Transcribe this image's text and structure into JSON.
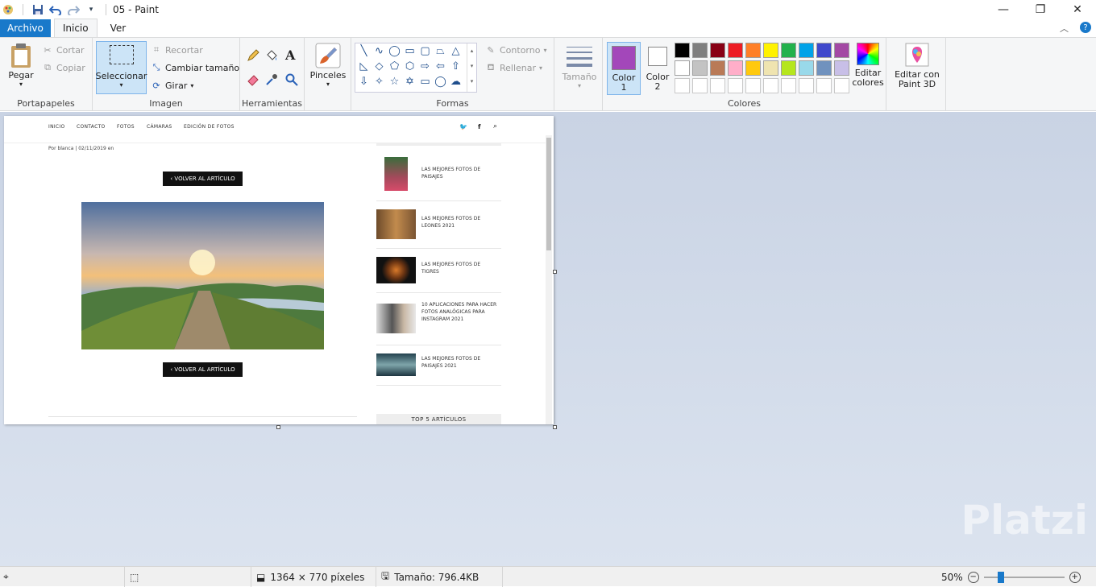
{
  "window": {
    "title": "05 - Paint",
    "minimize": "—",
    "maximize": "❐",
    "close": "✕"
  },
  "tabs": {
    "file": "Archivo",
    "home": "Inicio",
    "view": "Ver"
  },
  "ribbon": {
    "clipboard": {
      "label": "Portapapeles",
      "paste": "Pegar",
      "cut": "Cortar",
      "copy": "Copiar"
    },
    "image": {
      "label": "Imagen",
      "select": "Seleccionar",
      "crop": "Recortar",
      "resize": "Cambiar tamaño",
      "rotate": "Girar"
    },
    "tools": {
      "label": "Herramientas"
    },
    "brushes": {
      "label": "Pinceles"
    },
    "shapes": {
      "label": "Formas",
      "outline": "Contorno",
      "fill": "Rellenar"
    },
    "size": {
      "label": "Tamaño"
    },
    "colors": {
      "label": "Colores",
      "color1": "Color 1",
      "color2": "Color 2",
      "edit": "Editar colores",
      "color1_value": "#a347ba",
      "color2_value": "#ffffff",
      "palette_row1": [
        "#000000",
        "#7f7f7f",
        "#880015",
        "#ed1c24",
        "#ff7f27",
        "#fff200",
        "#22b14c",
        "#00a2e8",
        "#3f48cc",
        "#a349a4"
      ],
      "palette_row2": [
        "#ffffff",
        "#c3c3c3",
        "#b97a57",
        "#ffaec9",
        "#ffc90e",
        "#efe4b0",
        "#b5e61d",
        "#99d9ea",
        "#7092be",
        "#c8bfe7"
      ],
      "palette_row3": [
        "#ffffff",
        "#ffffff",
        "#ffffff",
        "#ffffff",
        "#ffffff",
        "#ffffff",
        "#ffffff",
        "#ffffff",
        "#ffffff",
        "#ffffff"
      ]
    },
    "paint3d": {
      "label": "Editar con Paint 3D"
    }
  },
  "webpage": {
    "nav": [
      "INICIO",
      "CONTACTO",
      "FOTOS",
      "CÁMARAS",
      "EDICIÓN DE FOTOS"
    ],
    "byline": "Por blanca | 02/11/2019 en",
    "back_button": "‹ VOLVER AL ARTÍCULO",
    "sidebar": [
      "LAS MEJORES FOTOS DE PAISAJES",
      "LAS MEJORES FOTOS DE LEONES 2021",
      "LAS MEJORES FOTOS DE TIGRES",
      "10 APLICACIONES PARA HACER FOTOS ANALÓGICAS PARA INSTAGRAM 2021",
      "LAS MEJORES FOTOS DE PAISAJES 2021"
    ],
    "top5": "TOP 5 ARTÍCULOS"
  },
  "status": {
    "dimensions": "1364 × 770 píxeles",
    "size": "Tamaño: 796.4KB",
    "zoom": "50%"
  },
  "watermark": "Platzi"
}
